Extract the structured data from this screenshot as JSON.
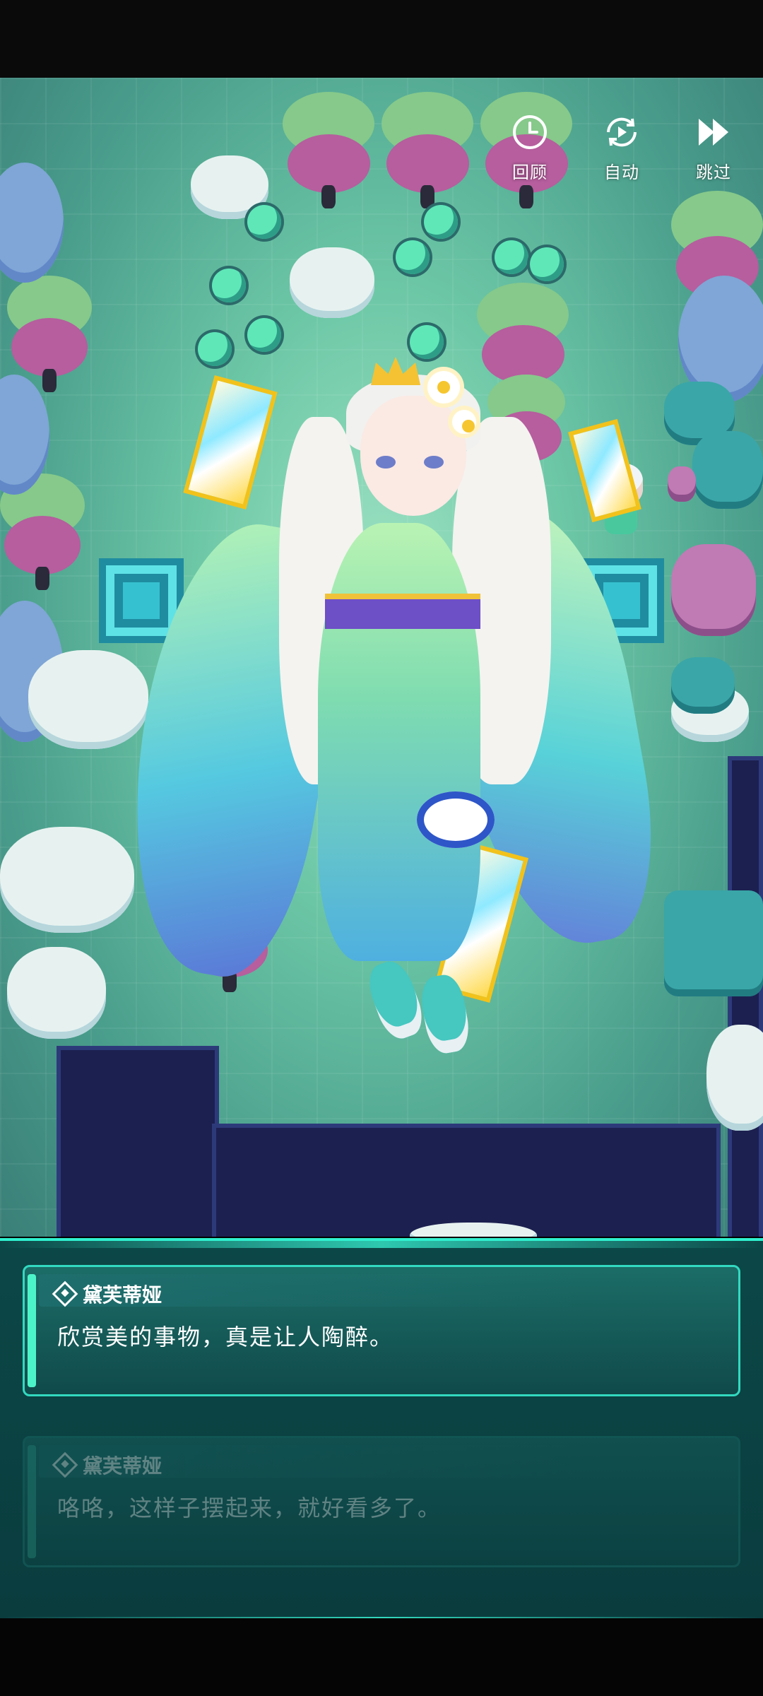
{
  "controls": [
    {
      "id": "review",
      "label": "回顾",
      "icon": "clock-icon"
    },
    {
      "id": "auto",
      "label": "自动",
      "icon": "auto-play-icon"
    },
    {
      "id": "skip",
      "label": "跳过",
      "icon": "fast-forward-icon"
    }
  ],
  "dialogue": {
    "current": {
      "speaker": "黛芙蒂娅",
      "text": "欣赏美的事物，真是让人陶醉。"
    },
    "previous": {
      "speaker": "黛芙蒂娅",
      "text": "咯咯，这样子摆起来，就好看多了。"
    }
  },
  "colors": {
    "accent": "#32d9c0",
    "dialog_bg": "#0c4747",
    "scene_ground": "#6cc7a6",
    "void": "#1c2050"
  }
}
